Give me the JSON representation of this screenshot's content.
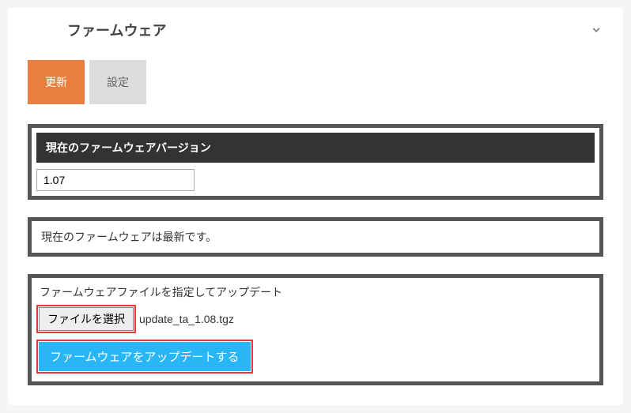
{
  "header": {
    "title": "ファームウェア"
  },
  "tabs": {
    "update": "更新",
    "settings": "設定"
  },
  "version_section": {
    "header": "現在のファームウェアバージョン",
    "value": "1.07"
  },
  "status": {
    "message": "現在のファームウェアは最新です。"
  },
  "upload": {
    "label": "ファームウェアファイルを指定してアップデート",
    "choose_button": "ファイルを選択",
    "file_name": "update_ta_1.08.tgz",
    "update_button": "ファームウェアをアップデートする"
  }
}
